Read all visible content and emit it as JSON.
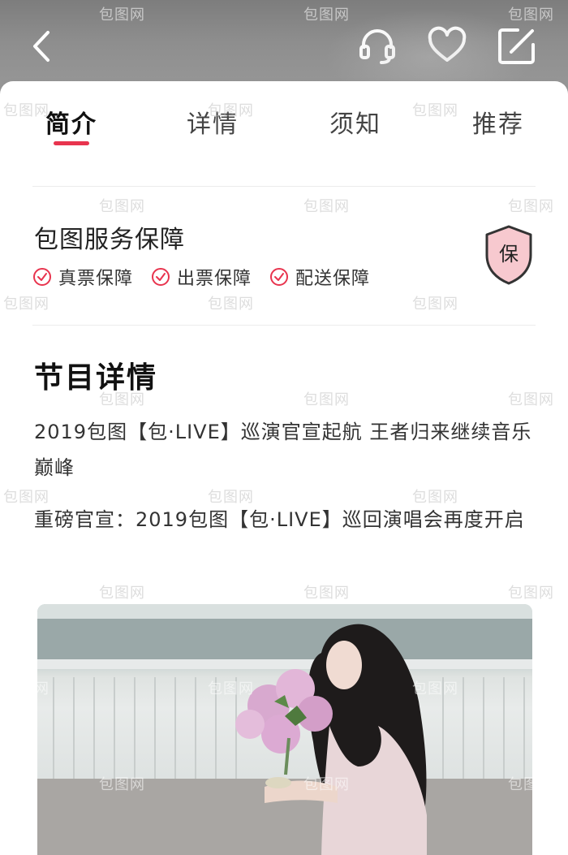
{
  "header": {
    "back_icon": "chevron-left-icon",
    "service_icon": "headset-icon",
    "favorite_icon": "heart-icon",
    "share_icon": "share-icon"
  },
  "tabs": [
    {
      "label": "简介",
      "active": true
    },
    {
      "label": "详情",
      "active": false
    },
    {
      "label": "须知",
      "active": false
    },
    {
      "label": "推荐",
      "active": false
    }
  ],
  "guarantee": {
    "title": "包图服务保障",
    "items": [
      {
        "label": "真票保障"
      },
      {
        "label": "出票保障"
      },
      {
        "label": "配送保障"
      }
    ],
    "badge": "保"
  },
  "details": {
    "title": "节目详情",
    "paragraphs": [
      "2019包图【包·LIVE】巡演官宣起航 王者归来继续音乐巅峰",
      "重磅官宣：2019包图【包·LIVE】巡回演唱会再度开启"
    ]
  },
  "watermark": "包图网",
  "colors": {
    "accent": "#e8344e",
    "shield_fill": "#f7c9cf"
  }
}
